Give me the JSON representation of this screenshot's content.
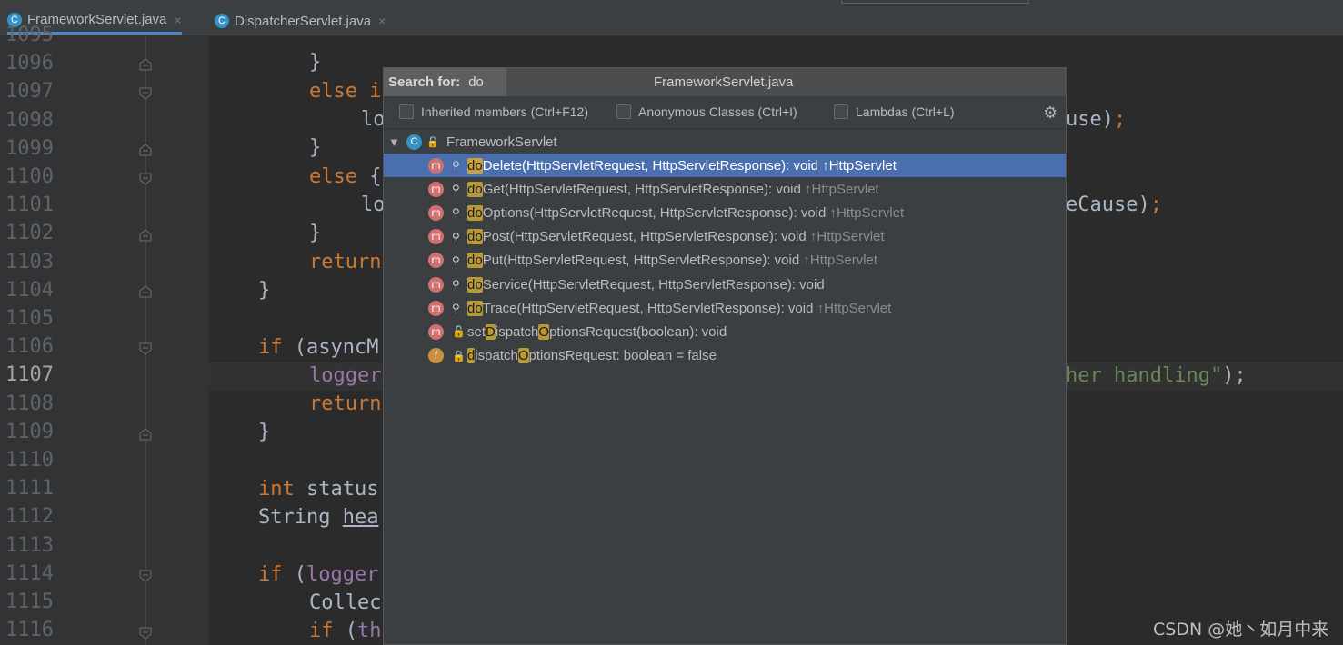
{
  "tabs": [
    {
      "label": "FrameworkServlet.java",
      "icon": "java-class-icon",
      "close": "×",
      "active": true
    },
    {
      "label": "DispatcherServlet.java",
      "icon": "java-class-icon",
      "close": "×",
      "active": false
    }
  ],
  "line_numbers": [
    "1095",
    "1096",
    "1097",
    "1098",
    "1099",
    "1100",
    "1101",
    "1102",
    "1103",
    "1104",
    "1105",
    "1106",
    "1107",
    "1108",
    "1109",
    "1110",
    "1111",
    "1112",
    "1113",
    "1114",
    "1115",
    "1116"
  ],
  "current_line": "1107",
  "code": {
    "l1096": "}",
    "l1097_kw": "else i",
    "l1098": "lo",
    "l1098_right": "use)",
    "l1099": "}",
    "l1100_kw": "else",
    "l1100_rest": " {",
    "l1101": "lo",
    "l1101_right": "eCause)",
    "l1102": "}",
    "l1103_kw": "return",
    "l1104": "}",
    "l1106_kw": "if",
    "l1106_rest": " (asyncM",
    "l1107": "logger",
    "l1107_right": "her handling\"",
    "l1107_end": ");",
    "l1108_kw": "return",
    "l1109": "}",
    "l1111_kw": "int",
    "l1111_rest": " status",
    "l1112_a": "String ",
    "l1112_b": "hea",
    "l1114_kw": "if",
    "l1114_rest": " (",
    "l1114_fld": "logger",
    "l1115": "Collec",
    "l1116_kw": "if",
    "l1116_rest": " (",
    "l1116_fld": "th",
    "semicolon": ";"
  },
  "popup": {
    "search_label": "Search for:",
    "search_value": "do",
    "title": "FrameworkServlet.java",
    "options": [
      {
        "label": "Inherited members (Ctrl+F12)",
        "checked": false
      },
      {
        "label": "Anonymous Classes (Ctrl+I)",
        "checked": false
      },
      {
        "label": "Lambdas (Ctrl+L)",
        "checked": false
      }
    ],
    "settings_icon": "gear-icon",
    "root": {
      "expand": "▼",
      "label": "FrameworkServlet"
    },
    "members": [
      {
        "pre": "",
        "m1": "do",
        "mid": "Delete(HttpServletRequest, HttpServletResponse): void ",
        "m2": "",
        "post": "",
        "inherit": "↑HttpServlet",
        "kind": "m",
        "selected": true
      },
      {
        "pre": "",
        "m1": "do",
        "mid": "Get(HttpServletRequest, HttpServletResponse): void ",
        "m2": "",
        "post": "",
        "inherit": "↑HttpServlet",
        "kind": "m",
        "selected": false
      },
      {
        "pre": "",
        "m1": "do",
        "mid": "Options(HttpServletRequest, HttpServletResponse): void ",
        "m2": "",
        "post": "",
        "inherit": "↑HttpServlet",
        "kind": "m",
        "selected": false
      },
      {
        "pre": "",
        "m1": "do",
        "mid": "Post(HttpServletRequest, HttpServletResponse): void ",
        "m2": "",
        "post": "",
        "inherit": "↑HttpServlet",
        "kind": "m",
        "selected": false
      },
      {
        "pre": "",
        "m1": "do",
        "mid": "Put(HttpServletRequest, HttpServletResponse): void ",
        "m2": "",
        "post": "",
        "inherit": "↑HttpServlet",
        "kind": "m",
        "selected": false
      },
      {
        "pre": "",
        "m1": "do",
        "mid": "Service(HttpServletRequest, HttpServletResponse): void",
        "m2": "",
        "post": "",
        "inherit": "",
        "kind": "m",
        "selected": false
      },
      {
        "pre": "",
        "m1": "do",
        "mid": "Trace(HttpServletRequest, HttpServletResponse): void ",
        "m2": "",
        "post": "",
        "inherit": "↑HttpServlet",
        "kind": "m",
        "selected": false
      },
      {
        "pre": "set",
        "m1": "D",
        "mid": "ispatch",
        "m2": "O",
        "post": "ptionsRequest(boolean): void",
        "inherit": "",
        "kind": "m",
        "selected": false
      },
      {
        "pre": "",
        "m1": "d",
        "mid": "ispatch",
        "m2": "O",
        "post": "ptionsRequest: boolean = false",
        "inherit": "",
        "kind": "f",
        "selected": false
      }
    ]
  },
  "watermark": "CSDN @她丶如月中来",
  "colors": {
    "keyword": "#cc7832",
    "string": "#6a8759",
    "selection": "#4b6eaf",
    "highlight": "#b89937"
  }
}
